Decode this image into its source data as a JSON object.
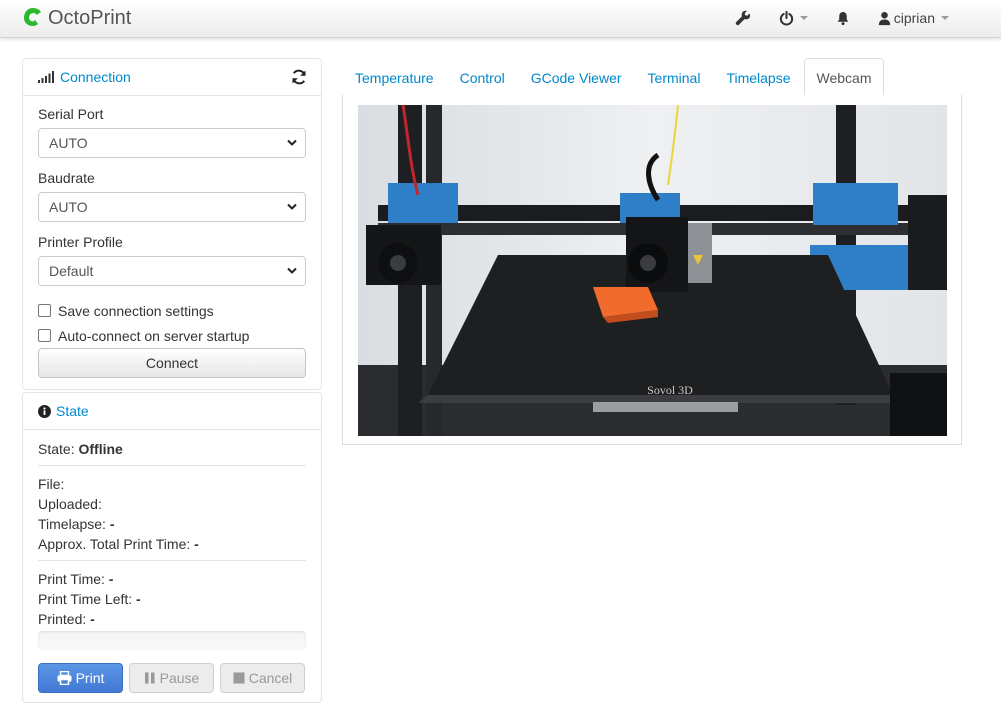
{
  "navbar": {
    "brand": "OctoPrint",
    "user": "ciprian",
    "icons": [
      "wrench-icon",
      "power-icon",
      "bell-icon",
      "user-icon"
    ]
  },
  "connection": {
    "title": "Connection",
    "serial_port_label": "Serial Port",
    "serial_port_value": "AUTO",
    "baudrate_label": "Baudrate",
    "baudrate_value": "AUTO",
    "profile_label": "Printer Profile",
    "profile_value": "Default",
    "save_settings_label": "Save connection settings",
    "autoconnect_label": "Auto-connect on server startup",
    "connect_button": "Connect"
  },
  "state": {
    "title": "State",
    "state_label": "State:",
    "state_value": "Offline",
    "file_label": "File:",
    "uploaded_label": "Uploaded:",
    "timelapse_label": "Timelapse:",
    "timelapse_value": "-",
    "approx_label": "Approx. Total Print Time:",
    "approx_value": "-",
    "print_time_label": "Print Time:",
    "print_time_value": "-",
    "time_left_label": "Print Time Left:",
    "time_left_value": "-",
    "printed_label": "Printed:",
    "printed_value": "-",
    "progress": 0,
    "print_button": "Print",
    "pause_button": "Pause",
    "cancel_button": "Cancel"
  },
  "tabs": [
    {
      "label": "Temperature"
    },
    {
      "label": "Control"
    },
    {
      "label": "GCode Viewer"
    },
    {
      "label": "Terminal"
    },
    {
      "label": "Timelapse"
    },
    {
      "label": "Webcam"
    }
  ],
  "active_tab": "Webcam",
  "webcam": {
    "bed_label": "Sovol 3D"
  },
  "colors": {
    "link": "#0088cc",
    "print_button": "#4a85dc",
    "brand_logo": "#2eb82e"
  }
}
